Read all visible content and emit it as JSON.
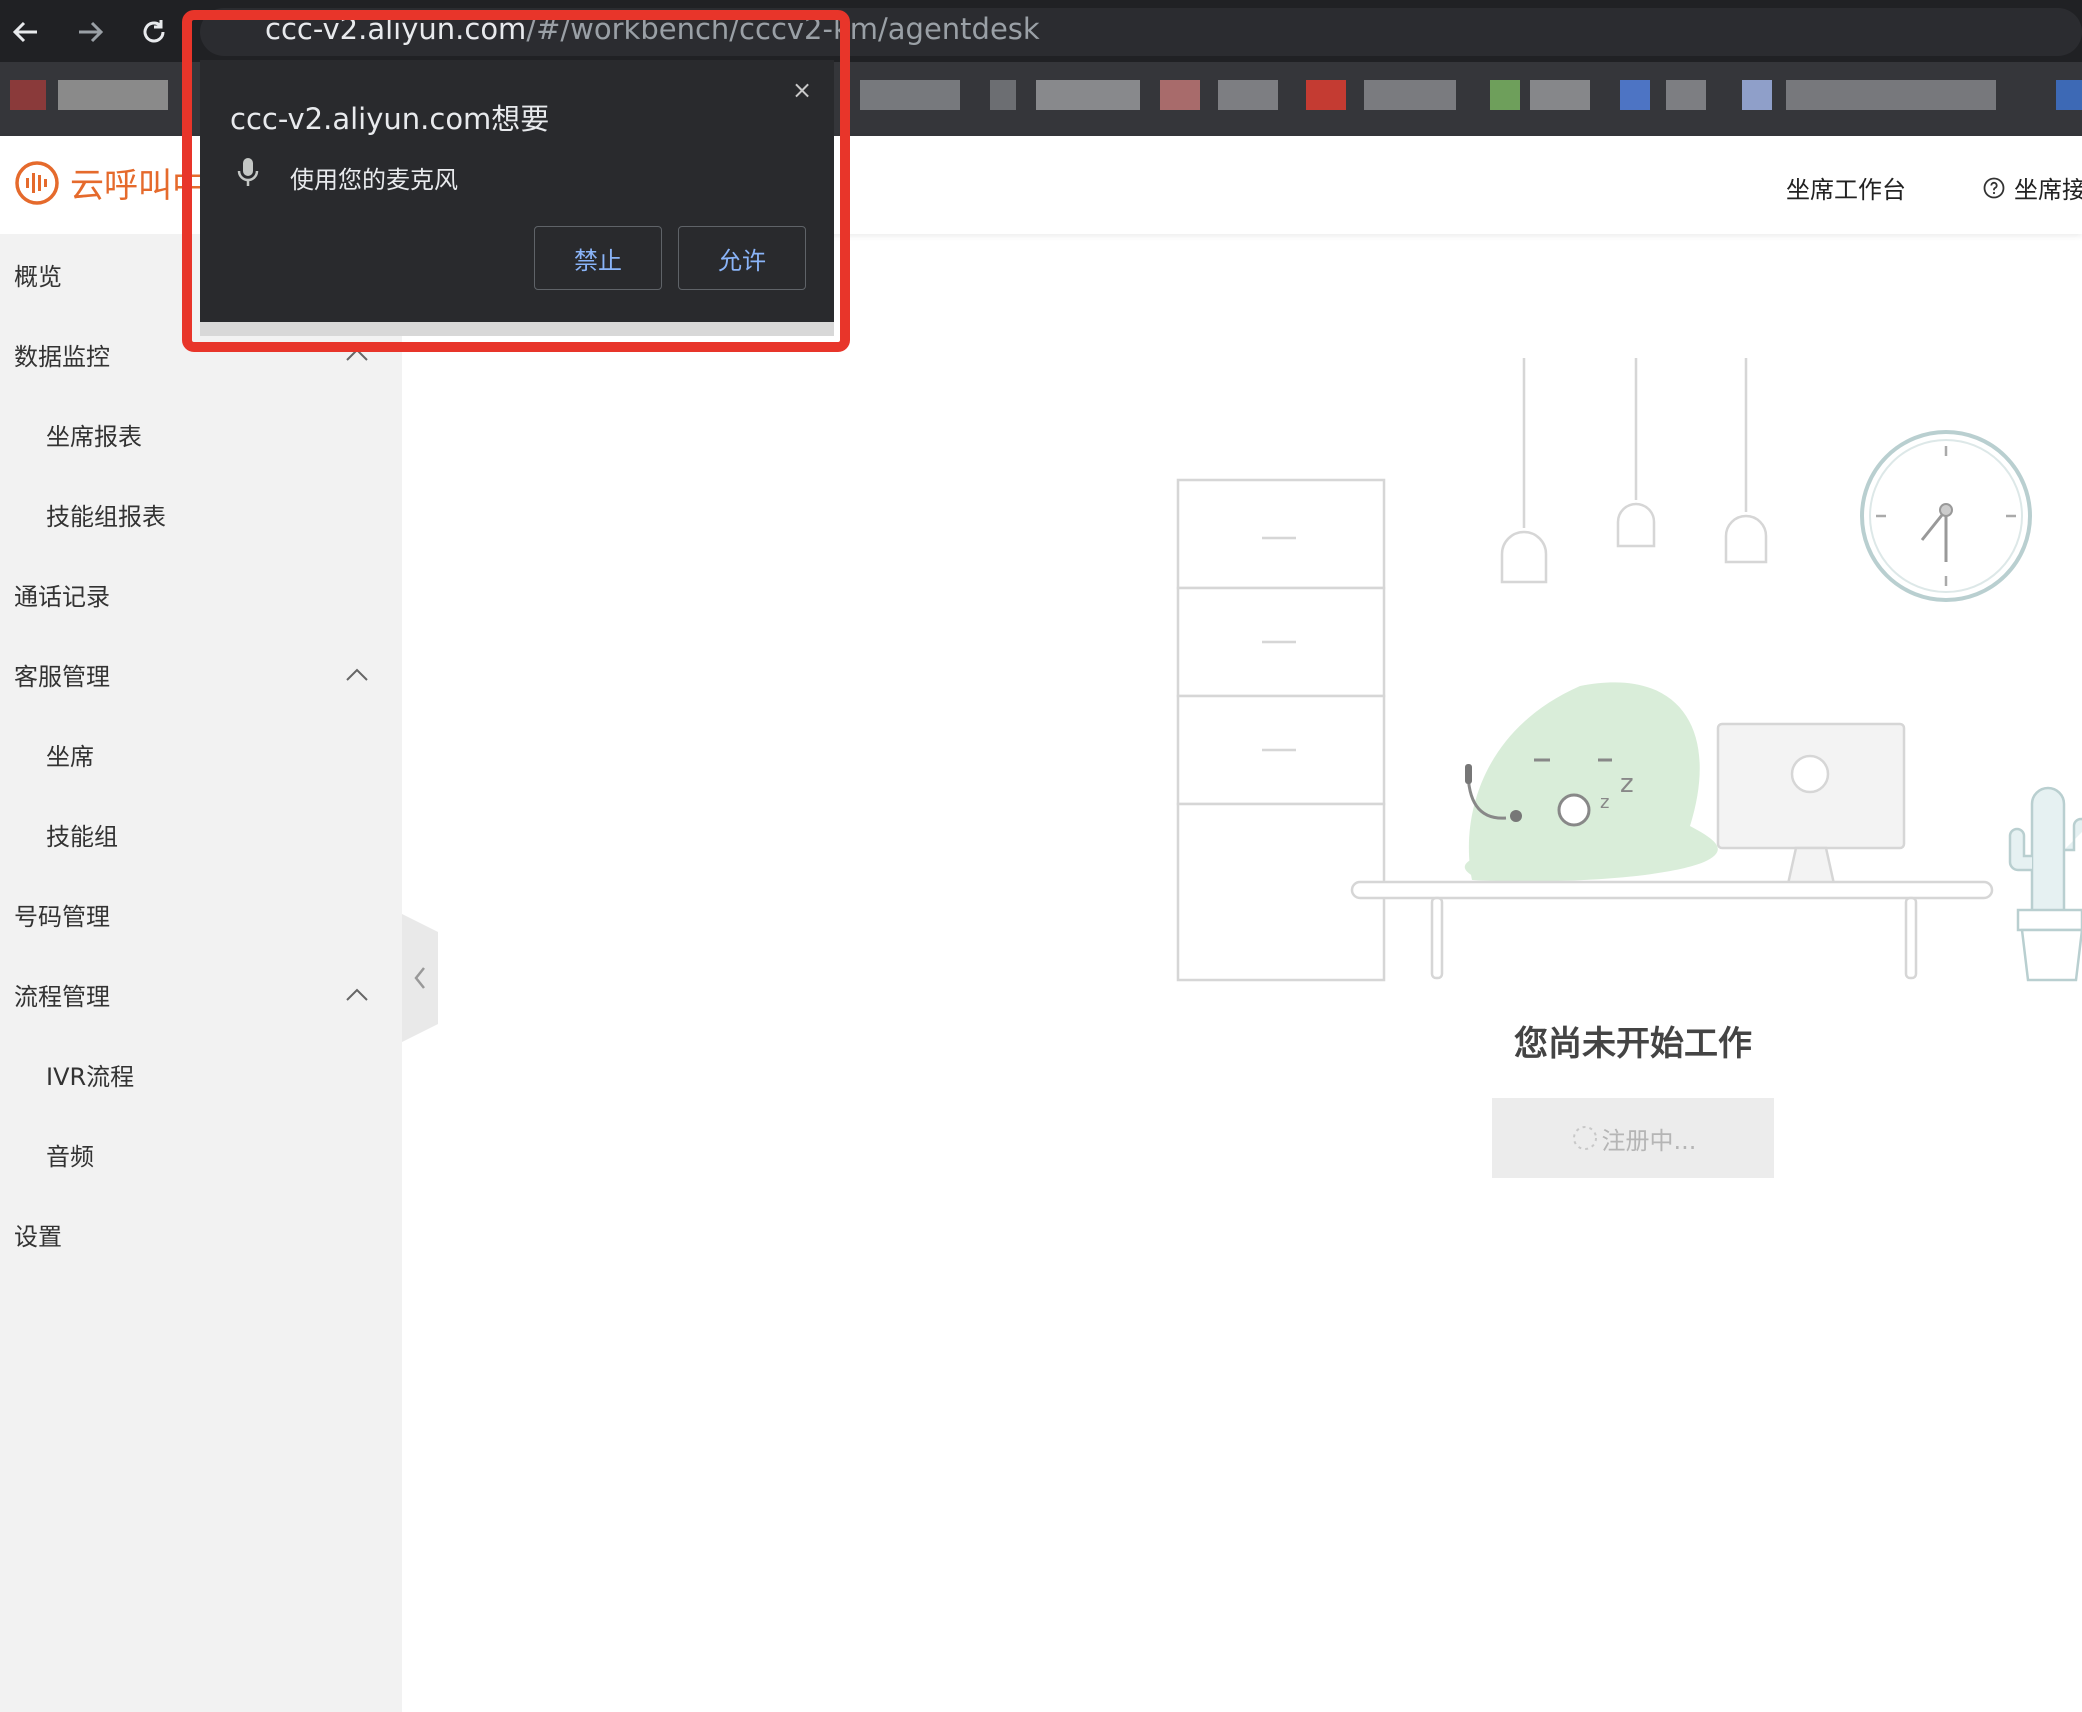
{
  "browser": {
    "url_host": "ccc-v2.aliyun.com",
    "url_path": "/#/workbench/cccv2-km",
    "url_tail": "/agentdesk"
  },
  "app": {
    "logo_text": "云呼叫中",
    "header_links": [
      "坐席工作台",
      "坐席接"
    ]
  },
  "sidebar": {
    "items": [
      {
        "label": "概览",
        "level": 0
      },
      {
        "label": "数据监控",
        "level": 0,
        "expanded": true
      },
      {
        "label": "坐席报表",
        "level": 1
      },
      {
        "label": "技能组报表",
        "level": 1
      },
      {
        "label": "通话记录",
        "level": 0
      },
      {
        "label": "客服管理",
        "level": 0,
        "expanded": true
      },
      {
        "label": "坐席",
        "level": 1
      },
      {
        "label": "技能组",
        "level": 1
      },
      {
        "label": "号码管理",
        "level": 0
      },
      {
        "label": "流程管理",
        "level": 0,
        "expanded": true
      },
      {
        "label": "IVR流程",
        "level": 1
      },
      {
        "label": "音频",
        "level": 1
      },
      {
        "label": "设置",
        "level": 0
      }
    ]
  },
  "main": {
    "status_title": "您尚未开始工作",
    "register_label": "注册中..."
  },
  "permission_popup": {
    "title": "ccc-v2.aliyun.com想要",
    "permission_text": "使用您的麦克风",
    "deny_label": "禁止",
    "allow_label": "允许",
    "close_symbol": "×",
    "highlight_color": "#e8352a"
  },
  "colors": {
    "brand": "#e56a2c",
    "mascot": "#d9edd9",
    "link_blue": "#8ab4f8"
  }
}
